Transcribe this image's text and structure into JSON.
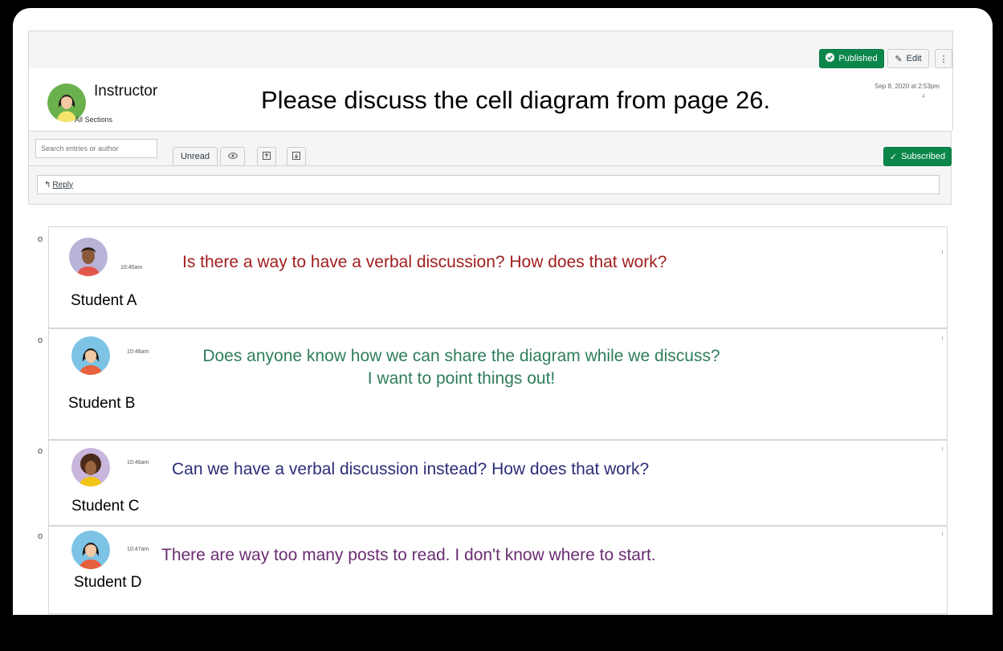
{
  "header_actions": {
    "published": "Published",
    "edit": "Edit",
    "more": "⋮"
  },
  "instructor": {
    "name": "Instructor",
    "sections": "All Sections",
    "date": "Sep 8, 2020 at 2:53pm",
    "count": "4"
  },
  "topic": "Please discuss the cell diagram from page 26.",
  "toolbar": {
    "search_placeholder": "Search entries or author",
    "unread": "Unread",
    "subscribed": "Subscribed"
  },
  "reply": {
    "label": "Reply"
  },
  "entries": [
    {
      "name": "Student A",
      "time": "10:45am",
      "message": "Is there a way to have a verbal discussion? How does that work?",
      "color": "#a01e1e"
    },
    {
      "name": "Student B",
      "time": "10:46am",
      "message_line1": "Does anyone know how we can share the diagram while we discuss?",
      "message_line2": "I want to point things out!",
      "color": "#2e7d5b"
    },
    {
      "name": "Student C",
      "time": "10:46am",
      "message": "Can we have a verbal discussion instead? How does that work?",
      "color": "#2b2d78"
    },
    {
      "name": "Student D",
      "time": "10:47am",
      "message": "There are way too many posts to read. I don't know where to start.",
      "color": "#6a2d72"
    }
  ],
  "colors": {
    "green": "#0b874b",
    "border": "#d7d7d7",
    "bar_bg": "#f5f5f5"
  }
}
